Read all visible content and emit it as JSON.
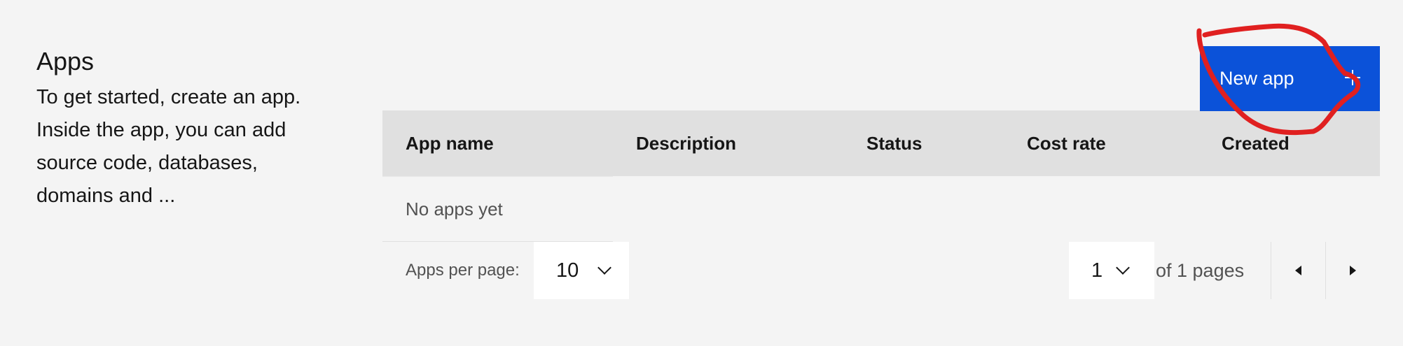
{
  "intro": {
    "title": "Apps",
    "description": "To get started, create an app. Inside the app, you can add source code, databases, domains and ..."
  },
  "toolbar": {
    "new_app_label": "New app",
    "accent_color": "#0b52d9"
  },
  "table": {
    "columns": [
      "App name",
      "Description",
      "Status",
      "Cost rate",
      "Created"
    ],
    "empty_message": "No apps yet"
  },
  "pagination": {
    "per_page_label": "Apps per page:",
    "per_page_value": "10",
    "current_page": "1",
    "of_pages_text": "of 1 pages"
  },
  "annotation": {
    "color": "#e02020"
  }
}
